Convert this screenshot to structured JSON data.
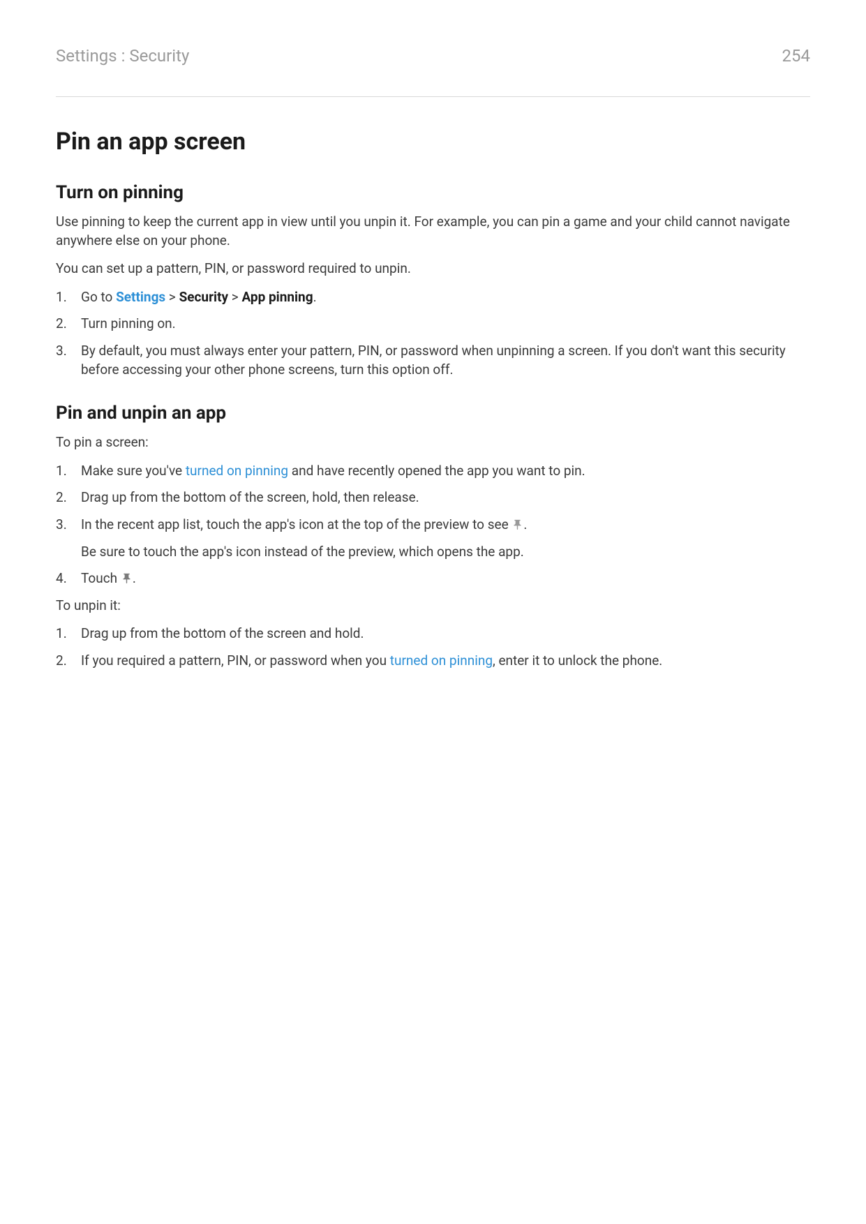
{
  "header": {
    "breadcrumb": "Settings : Security",
    "pageNumber": "254"
  },
  "title": "Pin an app screen",
  "section1": {
    "heading": "Turn on pinning",
    "p1": "Use pinning to keep the current app in view until you unpin it. For example, you can pin a game and your child cannot navigate anywhere else on your phone.",
    "p2": "You can set up a pattern, PIN, or password required to unpin.",
    "step1_prefix": "Go to ",
    "step1_link": "Settings",
    "step1_sep1": " > ",
    "step1_b1": "Security",
    "step1_sep2": " > ",
    "step1_b2": "App pinning",
    "step1_suffix": ".",
    "step2": "Turn pinning on.",
    "step3": "By default, you must always enter your pattern, PIN, or password when unpinning a screen. If you don't want this security before accessing your other phone screens, turn this option off."
  },
  "section2": {
    "heading": "Pin and unpin an app",
    "p1": "To pin a screen:",
    "step1_a": "Make sure you've ",
    "step1_link": "turned on pinning",
    "step1_b": " and have recently opened the app you want to pin.",
    "step2": "Drag up from the bottom of the screen, hold, then release.",
    "step3_a": "In the recent app list, touch the app's icon at the top of the preview to see ",
    "step3_b": ".",
    "step3_sub": "Be sure to touch the app's icon instead of the preview, which opens the app.",
    "step4_a": "Touch ",
    "step4_b": ".",
    "p2": "To unpin it:",
    "unpin_step1": "Drag up from the bottom of the screen and hold.",
    "unpin_step2_a": "If you required a pattern, PIN, or password when you ",
    "unpin_step2_link": "turned on pinning",
    "unpin_step2_b": ", enter it to unlock the phone."
  }
}
